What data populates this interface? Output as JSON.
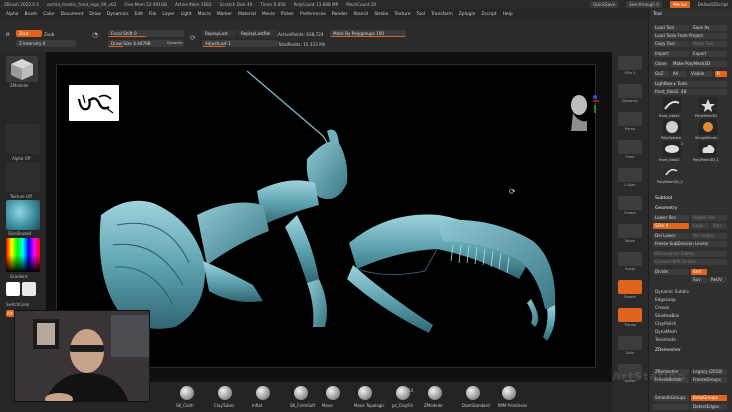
{
  "titlebar": {
    "app": "ZBrush 2022.0.5",
    "file": "orchid_mantis_front_legs_09_v03",
    "free_mem": "Free Mem 52.491GB",
    "active_mem": "Active Mem 3583",
    "scratch_disk": "Scratch Disk 49",
    "timer": "Timer 0.056",
    "poly_count": "PolyCount 13.688 MP",
    "mesh_count": "MeshCount 20",
    "quicksave": "QuickSave",
    "see_through": "See-through 0",
    "menus": "Menus",
    "default_zscript": "DefaultZScript"
  },
  "menubar": {
    "items": [
      "Alpha",
      "Brush",
      "Color",
      "Document",
      "Draw",
      "Dynamics",
      "Edit",
      "File",
      "Layer",
      "Light",
      "Macro",
      "Marker",
      "Material",
      "Movie",
      "Picker",
      "Preferences",
      "Render",
      "Stencil",
      "Stroke",
      "Texture",
      "Tool",
      "Transform",
      "Zplugin",
      "Zscript",
      "Help"
    ]
  },
  "toolbar": {
    "mode_m": "M",
    "zcut": "Zcut",
    "zsub": "Zsub",
    "z_intensity": "Z Intensity 0",
    "focal_shift": "Focal Shift 0",
    "draw_size": "Draw Size 4.44708",
    "dynamic": "Dynamic",
    "replay_last": "ReplayLast",
    "replay_last_rel": "ReplayLastRel",
    "adjust_last": "AdjustLast 1",
    "active_points": "ActivePoints: 838,724",
    "total_points": "TotalPoints: 15.333 Mil",
    "mask_by_polygroups": "Mask By Polygroups 100"
  },
  "left_shelf": {
    "brush_label": "ZModeler",
    "alpha_label": "Alpha Off",
    "texture_label": "Texture Off",
    "material_label": "SkinShade4",
    "gradient_label": "Gradient",
    "switch_color_label": "SwitchColor",
    "alternate_label": "Alt"
  },
  "right_strip": {
    "labels": [
      "SPix 3",
      "Dynamic",
      "Persp",
      "Floor",
      "L.Sym",
      "Frame",
      "Move",
      "Scale",
      "Rotate",
      "Transp",
      "Solo",
      "Xpose"
    ]
  },
  "tool_panel": {
    "header": "Tool",
    "load_tool": "Load Tool",
    "save_as": "Save As",
    "load_tools_from_project": "Load Tools From Project",
    "copy_tool": "Copy Tool",
    "paste_tool": "Paste Tool",
    "import": "Import",
    "export": "Export",
    "clone": "Clone",
    "make_polymesh3d": "Make PolyMesh3D",
    "goz": "GoZ",
    "all": "All",
    "visible": "Visible",
    "r": "R",
    "lightbox_tools": "Lightbox ▸ Tools",
    "current_tool": "front_tibia2. 48",
    "tools": [
      "front_tibia2",
      "PolyMesh3D",
      "PolySphere",
      "SimpleBrush",
      "front_tibia2",
      "PolyMesh3D_1",
      "PolyMesh3D_2"
    ],
    "tool_counts": [
      "",
      "",
      "",
      "",
      "2",
      "",
      ""
    ],
    "subtool": "Subtool",
    "geometry": "Geometry",
    "lower_res": "Lower Res",
    "higher_res": "Higher Res",
    "sdiv": "SDiv 4",
    "cage": "Cage",
    "rstr": "Rstr",
    "del_lower": "Del Lower",
    "del_higher": "Del Higher",
    "freeze_subdivision_levels": "Freeze SubDivision Levels",
    "reconstruct_subdiv": "Reconstruct Subdiv",
    "convert_bpr_to_geo": "Convert BPR To Geo",
    "divide": "Divide",
    "smt": "Smt",
    "suv": "Suv",
    "reuv": "ReUV",
    "dynamic_subdiv": "Dynamic Subdiv",
    "edgeloop": "EdgeLoop",
    "crease": "Crease",
    "shadowbox": "ShadowBox",
    "clayPolish": "ClayPolish",
    "dynamesh": "DynaMesh",
    "tessimate": "Tessimate",
    "zremesher": "ZRemesher",
    "zremesher_btn": "ZRemesher",
    "legacy": "Legacy (2018)",
    "freeze_border": "FreezeBorder",
    "freeze_groups": "FreezeGroups",
    "smooth_groups": "SmoothGroups",
    "keep_groups": "KeepGroups",
    "detect_edges": "DetectEdges"
  },
  "bottom_shelf": {
    "brushes": [
      "SK_Cloth",
      "ClayTubes",
      "Inflat",
      "SK_FormSoft",
      "Move",
      "Move Topologic",
      "pz_ClayFill",
      "ZModeler",
      "DamStandard",
      "IMM Primitives"
    ],
    "counter": "14"
  },
  "watermark": "ArtStation"
}
